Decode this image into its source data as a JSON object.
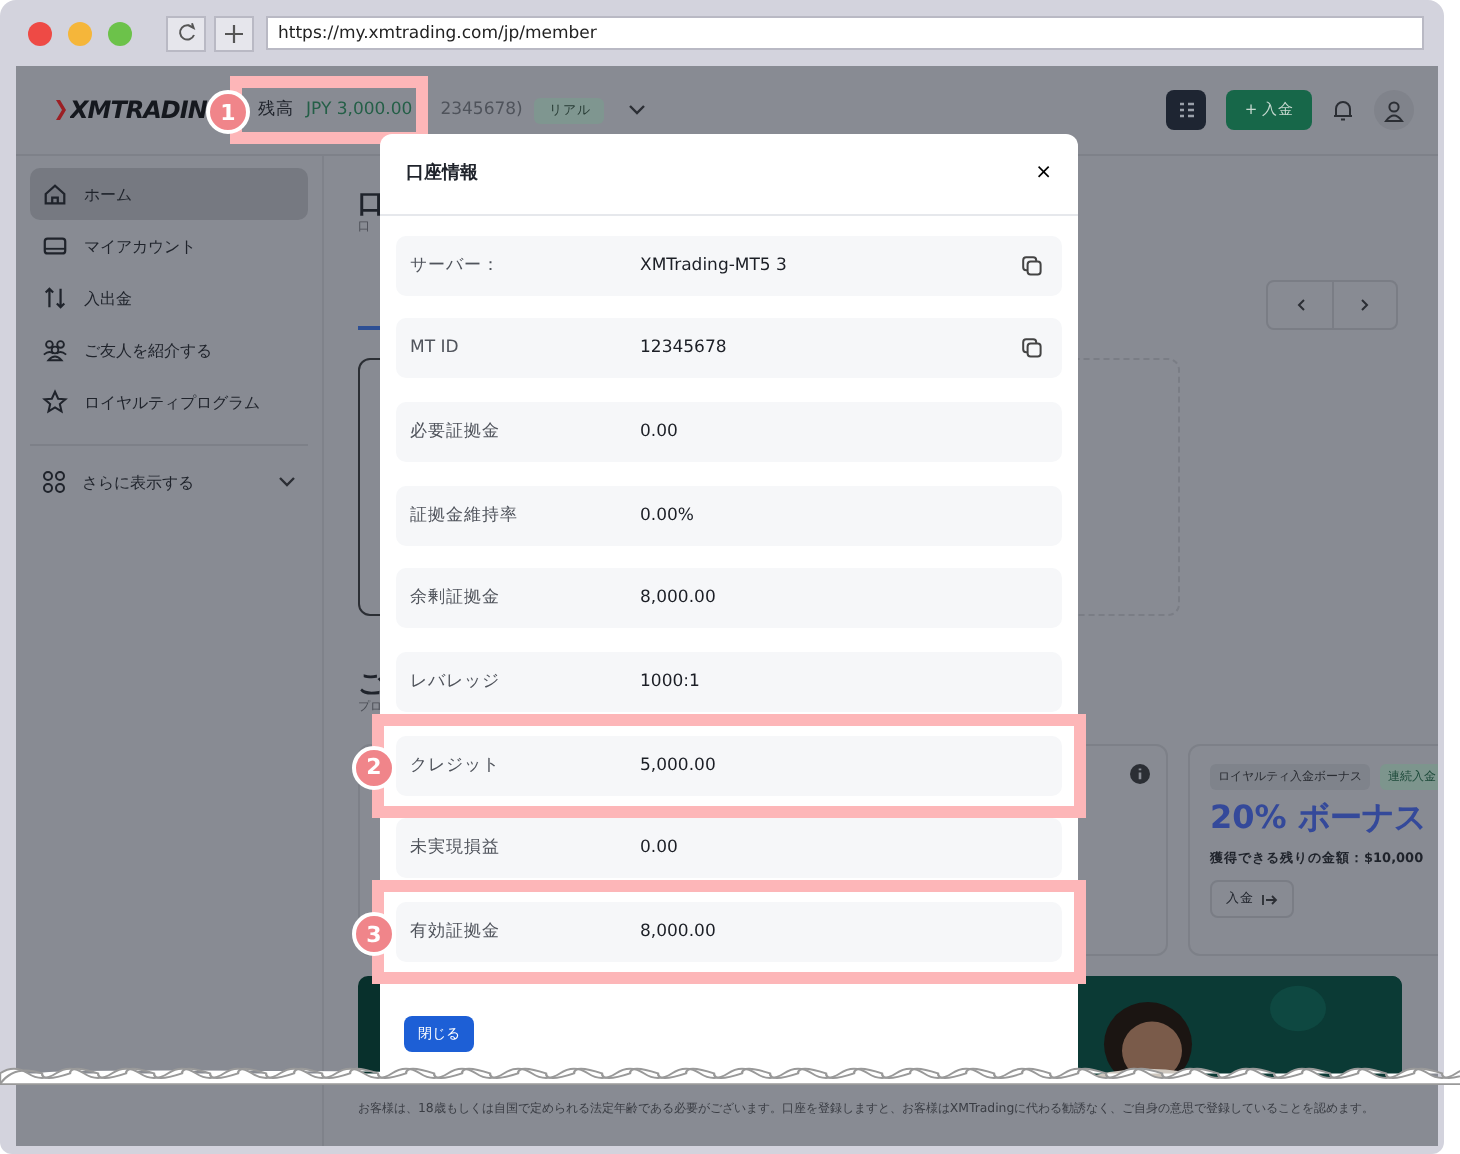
{
  "browser": {
    "url": "https://my.xmtrading.com/jp/member"
  },
  "header": {
    "logo": "XMTRADIN",
    "balance_label": "残高",
    "balance_value": "JPY 3,000.00",
    "balance_marker": "1",
    "account_number": "2345678)",
    "account_type": "リアル",
    "deposit_button": "+ 入金"
  },
  "sidebar": {
    "items": [
      {
        "label": "ホーム",
        "selected": true
      },
      {
        "label": "マイアカウント",
        "selected": false
      },
      {
        "label": "入出金",
        "selected": false
      },
      {
        "label": "ご友人を紹介する",
        "selected": false
      },
      {
        "label": "ロイヤルティプログラム",
        "selected": false
      }
    ],
    "more": "さらに表示する"
  },
  "main": {
    "heading": "口",
    "subtitle": "口",
    "section_heading": "ご",
    "section_subtitle": "プロ",
    "bonus_card": {
      "tags": [
        "ロイヤルティ入金ボーナス",
        "連続入金"
      ],
      "title": "20% ボーナス",
      "remaining": "獲得できる残りの金額：$10,000",
      "button": "入金"
    },
    "footer_text": "お客様は、18歳もしくは自国で定められる法定年齢である必要がございます。口座を登録しますと、お客様はXMTradingに代わる勧誘なく、ご自身の意思で登録していることを認めます。"
  },
  "modal": {
    "title": "口座情報",
    "close": "×",
    "rows": [
      {
        "label": "サーバー：",
        "value": "XMTrading-MT5 3",
        "copyable": true
      },
      {
        "label": "MT ID",
        "value": "12345678",
        "copyable": true
      },
      {
        "label": "必要証拠金",
        "value": "0.00",
        "copyable": false
      },
      {
        "label": "証拠金維持率",
        "value": "0.00%",
        "copyable": false
      },
      {
        "label": "余剰証拠金",
        "value": "8,000.00",
        "copyable": false
      },
      {
        "label": "レバレッジ",
        "value": "1000:1",
        "copyable": false
      },
      {
        "label": "クレジット",
        "value": "5,000.00",
        "copyable": false,
        "marker": "2"
      },
      {
        "label": "未実現損益",
        "value": "0.00",
        "copyable": false
      },
      {
        "label": "有効証拠金",
        "value": "8,000.00",
        "copyable": false,
        "marker": "3"
      }
    ],
    "close_button": "閉じる"
  }
}
